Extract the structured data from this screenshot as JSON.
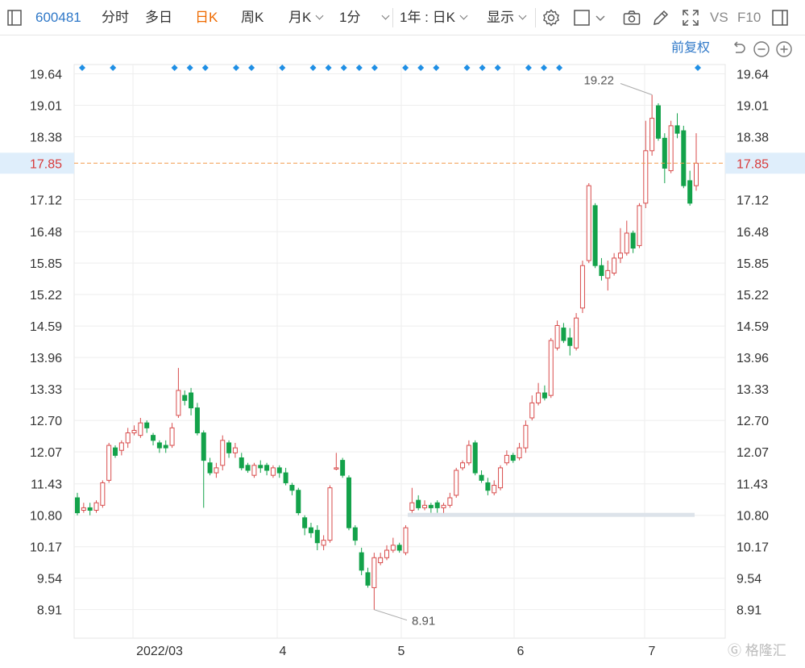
{
  "toolbar": {
    "code": "600481",
    "tab_intraday": "分时",
    "tab_multiday": "多日",
    "tab_daily": "日K",
    "tab_weekly": "周K",
    "tab_monthly": "月K",
    "tab_minute": "1分",
    "range_select": "1年 : 日K",
    "display_label": "显示",
    "vs_label": "VS",
    "f10_label": "F10",
    "active_color": "#ee6a00"
  },
  "adjust_label": "前复权",
  "watermark": "格隆汇",
  "icons": [
    "panel-icon",
    "chevron-down-icon",
    "settings-icon",
    "checkbox-icon",
    "camera-icon",
    "pencil-icon",
    "fullscreen-icon",
    "layout-icon",
    "undo-icon",
    "zoom-out-icon",
    "zoom-in-icon"
  ],
  "chart_data": {
    "type": "candlestick",
    "symbol": "600481",
    "up_color": "#d84b4b",
    "down_color": "#13a24a",
    "y_ticks": [
      "19.64",
      "19.01",
      "18.38",
      "17.85",
      "17.12",
      "16.48",
      "15.85",
      "15.22",
      "14.59",
      "13.96",
      "13.33",
      "12.70",
      "12.07",
      "11.43",
      "10.80",
      "10.17",
      "9.54",
      "8.91"
    ],
    "ylim": [
      8.5,
      19.9
    ],
    "x_ticks": [
      "2022/03",
      "4",
      "5",
      "6",
      "7"
    ],
    "current_price": "17.85",
    "max_label": "19.22",
    "min_label": "8.91",
    "grid": true,
    "candles": [
      [
        11.15,
        10.85,
        11.25,
        10.8
      ],
      [
        10.9,
        10.95,
        11.05,
        10.85
      ],
      [
        10.95,
        10.9,
        11.05,
        10.8
      ],
      [
        10.9,
        11.05,
        11.1,
        10.85
      ],
      [
        11.0,
        11.45,
        11.5,
        10.95
      ],
      [
        11.5,
        12.2,
        12.25,
        11.45
      ],
      [
        12.15,
        12.0,
        12.2,
        11.95
      ],
      [
        12.1,
        12.25,
        12.3,
        12.0
      ],
      [
        12.25,
        12.45,
        12.55,
        12.15
      ],
      [
        12.45,
        12.5,
        12.6,
        12.4
      ],
      [
        12.4,
        12.65,
        12.75,
        12.35
      ],
      [
        12.65,
        12.55,
        12.7,
        12.45
      ],
      [
        12.4,
        12.3,
        12.45,
        12.2
      ],
      [
        12.25,
        12.15,
        12.3,
        12.05
      ],
      [
        12.2,
        12.15,
        12.3,
        12.05
      ],
      [
        12.2,
        12.55,
        12.65,
        12.15
      ],
      [
        12.8,
        13.3,
        13.75,
        12.75
      ],
      [
        13.2,
        13.1,
        13.3,
        13.0
      ],
      [
        13.25,
        12.95,
        13.35,
        12.8
      ],
      [
        12.95,
        12.45,
        13.05,
        12.4
      ],
      [
        12.45,
        11.9,
        12.5,
        10.95
      ],
      [
        11.85,
        11.65,
        11.95,
        11.6
      ],
      [
        11.65,
        11.75,
        11.85,
        11.55
      ],
      [
        11.8,
        12.3,
        12.4,
        11.7
      ],
      [
        12.25,
        12.05,
        12.3,
        11.95
      ],
      [
        12.05,
        12.15,
        12.25,
        11.95
      ],
      [
        11.95,
        11.75,
        12.05,
        11.7
      ],
      [
        11.8,
        11.7,
        11.85,
        11.65
      ],
      [
        11.6,
        11.8,
        11.85,
        11.55
      ],
      [
        11.8,
        11.75,
        11.9,
        11.65
      ],
      [
        11.8,
        11.7,
        11.85,
        11.6
      ],
      [
        11.6,
        11.75,
        11.8,
        11.55
      ],
      [
        11.75,
        11.65,
        11.8,
        11.55
      ],
      [
        11.65,
        11.45,
        11.75,
        11.4
      ],
      [
        11.4,
        11.3,
        11.45,
        11.2
      ],
      [
        11.3,
        10.85,
        11.35,
        10.8
      ],
      [
        10.75,
        10.55,
        10.8,
        10.4
      ],
      [
        10.55,
        10.45,
        10.65,
        10.35
      ],
      [
        10.5,
        10.25,
        10.6,
        10.1
      ],
      [
        10.2,
        10.3,
        10.4,
        10.1
      ],
      [
        10.3,
        11.35,
        11.4,
        10.25
      ],
      [
        11.75,
        11.75,
        12.05,
        11.7
      ],
      [
        11.9,
        11.6,
        11.95,
        11.55
      ],
      [
        11.55,
        10.55,
        11.6,
        10.5
      ],
      [
        10.55,
        10.3,
        10.6,
        10.2
      ],
      [
        10.05,
        9.7,
        10.15,
        9.6
      ],
      [
        9.65,
        9.4,
        9.75,
        9.35
      ],
      [
        9.35,
        9.95,
        10.05,
        8.91
      ],
      [
        9.85,
        9.95,
        10.05,
        9.8
      ],
      [
        9.95,
        10.1,
        10.2,
        9.9
      ],
      [
        10.1,
        10.2,
        10.35,
        10.05
      ],
      [
        10.2,
        10.1,
        10.25,
        10.05
      ],
      [
        10.05,
        10.55,
        10.6,
        10.0
      ],
      [
        10.9,
        11.05,
        11.35,
        10.85
      ],
      [
        11.1,
        10.95,
        11.2,
        10.9
      ],
      [
        10.95,
        11.0,
        11.1,
        10.9
      ],
      [
        11.0,
        10.95,
        11.05,
        10.85
      ],
      [
        11.05,
        10.95,
        11.1,
        10.85
      ],
      [
        10.95,
        11.0,
        11.05,
        10.8
      ],
      [
        11.0,
        11.15,
        11.25,
        10.95
      ],
      [
        11.2,
        11.7,
        11.75,
        11.15
      ],
      [
        11.75,
        11.85,
        11.9,
        11.7
      ],
      [
        11.85,
        12.2,
        12.3,
        11.8
      ],
      [
        12.25,
        11.65,
        12.3,
        11.6
      ],
      [
        11.6,
        11.5,
        11.7,
        11.45
      ],
      [
        11.45,
        11.3,
        11.55,
        11.2
      ],
      [
        11.25,
        11.4,
        11.5,
        11.2
      ],
      [
        11.35,
        11.75,
        11.8,
        11.3
      ],
      [
        11.85,
        12.0,
        12.1,
        11.8
      ],
      [
        12.0,
        11.9,
        12.05,
        11.85
      ],
      [
        11.95,
        12.15,
        12.25,
        11.9
      ],
      [
        12.15,
        12.6,
        12.7,
        12.05
      ],
      [
        12.75,
        13.05,
        13.2,
        12.7
      ],
      [
        13.05,
        13.25,
        13.45,
        13.0
      ],
      [
        13.25,
        13.15,
        13.4,
        13.1
      ],
      [
        13.2,
        14.3,
        14.35,
        13.15
      ],
      [
        14.15,
        14.6,
        14.7,
        14.1
      ],
      [
        14.55,
        14.3,
        14.65,
        14.25
      ],
      [
        14.35,
        14.2,
        14.55,
        14.0
      ],
      [
        14.15,
        14.75,
        14.85,
        14.1
      ],
      [
        14.95,
        15.8,
        15.9,
        14.85
      ],
      [
        15.9,
        17.4,
        17.45,
        15.85
      ],
      [
        17.0,
        15.8,
        17.05,
        15.75
      ],
      [
        15.8,
        15.6,
        15.95,
        15.5
      ],
      [
        15.55,
        15.7,
        15.9,
        15.3
      ],
      [
        15.65,
        15.95,
        16.05,
        15.6
      ],
      [
        15.95,
        16.05,
        16.55,
        15.85
      ],
      [
        16.05,
        16.45,
        16.7,
        16.0
      ],
      [
        16.45,
        16.15,
        16.5,
        16.05
      ],
      [
        16.2,
        17.0,
        17.05,
        16.15
      ],
      [
        17.05,
        18.1,
        18.7,
        16.95
      ],
      [
        18.1,
        18.75,
        19.22,
        18.0
      ],
      [
        19.0,
        18.35,
        19.05,
        18.3
      ],
      [
        18.35,
        17.75,
        18.45,
        17.45
      ],
      [
        17.7,
        18.6,
        18.7,
        17.65
      ],
      [
        18.6,
        18.45,
        18.85,
        18.35
      ],
      [
        18.5,
        17.4,
        18.6,
        17.35
      ],
      [
        17.5,
        17.05,
        17.7,
        17.0
      ],
      [
        17.4,
        17.85,
        18.45,
        17.3
      ]
    ]
  }
}
